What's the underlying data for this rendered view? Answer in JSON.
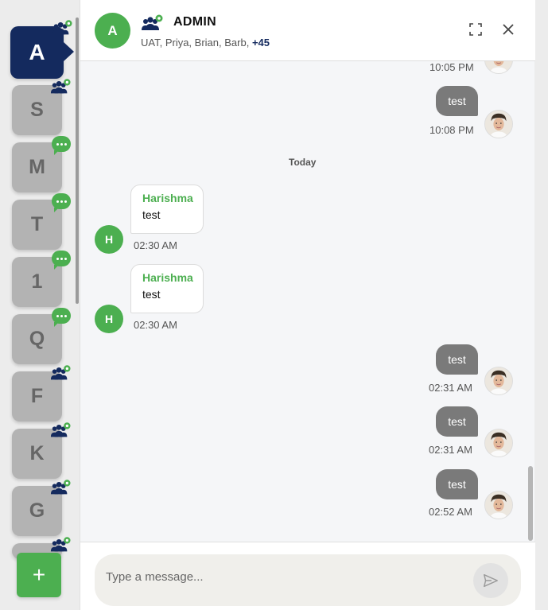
{
  "rail": {
    "tiles": [
      {
        "letter": "A",
        "badge": "group-settings"
      },
      {
        "letter": "S",
        "badge": "group-settings"
      },
      {
        "letter": "M",
        "badge": "chat"
      },
      {
        "letter": "T",
        "badge": "chat"
      },
      {
        "letter": "1",
        "badge": "chat"
      },
      {
        "letter": "Q",
        "badge": "chat"
      },
      {
        "letter": "F",
        "badge": "group-settings"
      },
      {
        "letter": "K",
        "badge": "group-settings"
      },
      {
        "letter": "G",
        "badge": "group-settings"
      }
    ],
    "add_label": "+"
  },
  "header": {
    "avatar_letter": "A",
    "title": "ADMIN",
    "members": "UAT, Priya, Brian, Barb,",
    "more": "+45"
  },
  "messages": {
    "day_separator": "Today",
    "items": [
      {
        "dir": "out",
        "text": "",
        "time": "10:05 PM"
      },
      {
        "dir": "out",
        "text": "test",
        "time": "10:08 PM"
      },
      {
        "dir": "in",
        "sender": "Harishma",
        "avatar": "H",
        "text": "test",
        "time": "02:30 AM"
      },
      {
        "dir": "in",
        "sender": "Harishma",
        "avatar": "H",
        "text": "test",
        "time": "02:30 AM"
      },
      {
        "dir": "out",
        "text": "test",
        "time": "02:31 AM"
      },
      {
        "dir": "out",
        "text": "test",
        "time": "02:31 AM"
      },
      {
        "dir": "out",
        "text": "test",
        "time": "02:52 AM"
      }
    ]
  },
  "composer": {
    "placeholder": "Type a message..."
  },
  "colors": {
    "accent_green": "#4caf50",
    "navy": "#142a5e",
    "out_bubble": "#7a7a7a"
  }
}
